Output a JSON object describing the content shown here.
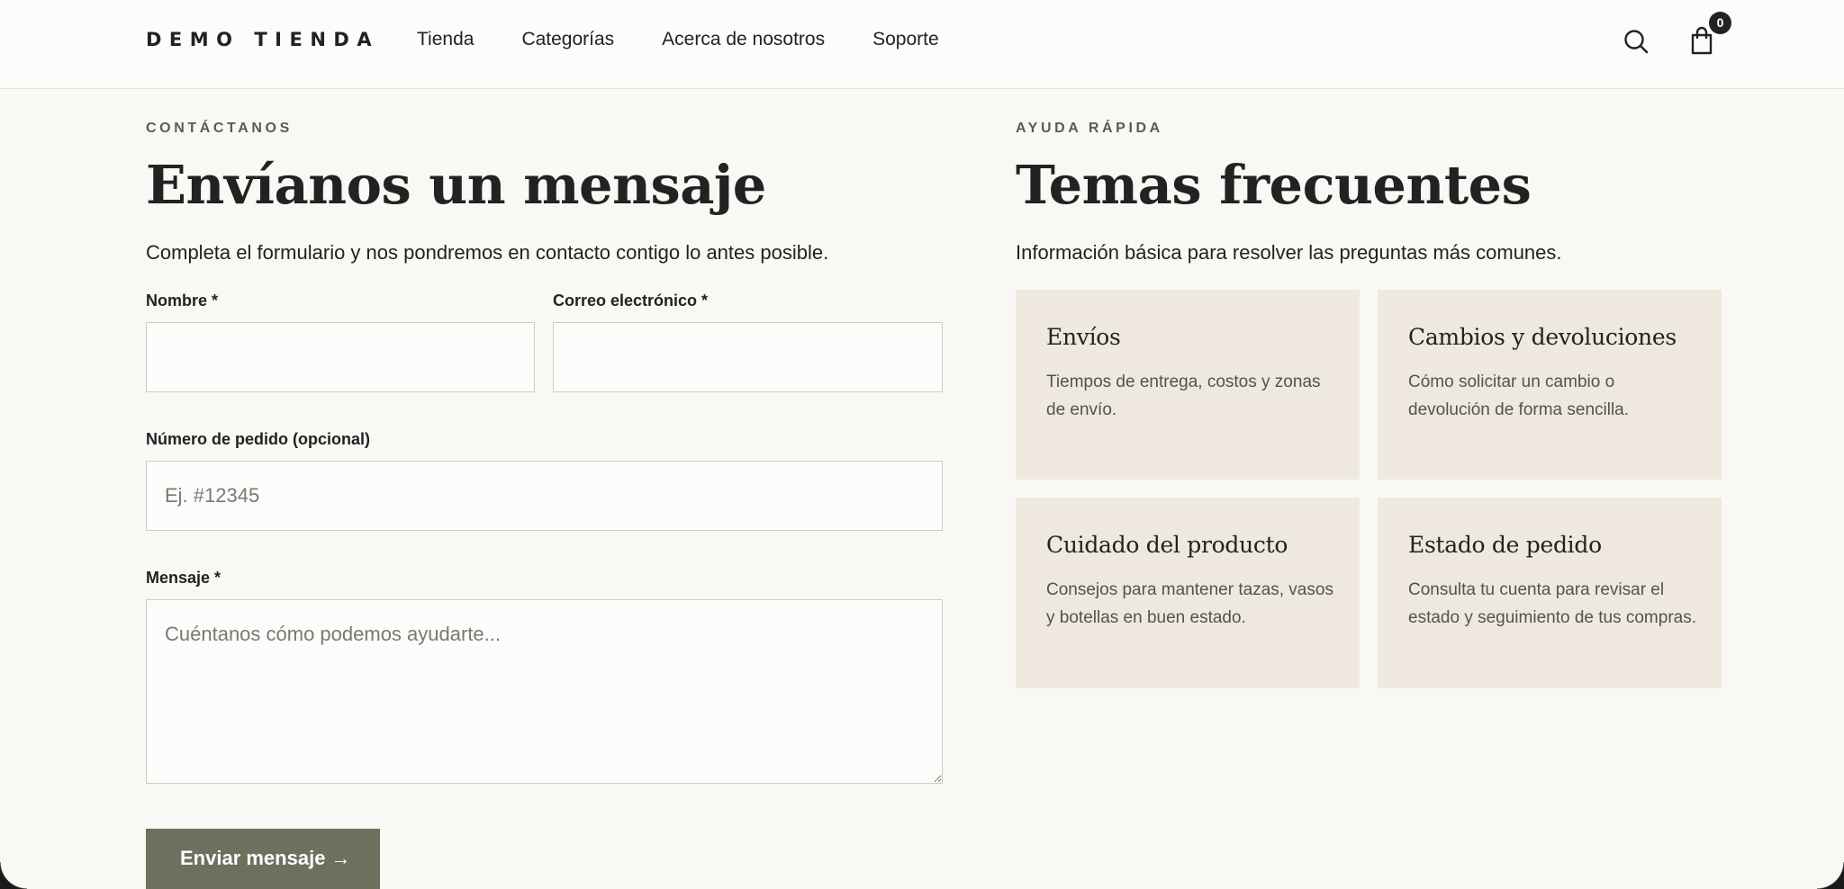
{
  "header": {
    "logo": "DEMO TIENDA",
    "nav": [
      "Tienda",
      "Categorías",
      "Acerca de nosotros",
      "Soporte"
    ],
    "cart_count": "0",
    "icons": [
      "search-icon",
      "shopping-bag-icon"
    ]
  },
  "contact": {
    "eyebrow": "CONTÁCTANOS",
    "title": "Envíanos un mensaje",
    "subtitle": "Completa el formulario y nos pondremos en contacto contigo lo antes posible.",
    "name_label": "Nombre *",
    "name_value": "",
    "email_label": "Correo electrónico *",
    "email_value": "",
    "order_label": "Número de pedido (opcional)",
    "order_placeholder": "Ej. #12345",
    "message_label": "Mensaje *",
    "message_placeholder": "Cuéntanos cómo podemos ayudarte...",
    "submit_label": "Enviar mensaje →",
    "button_color": "#6e6f5d"
  },
  "help": {
    "eyebrow": "AYUDA RÁPIDA",
    "title": "Temas frecuentes",
    "subtitle": "Información básica para resolver las preguntas más comunes.",
    "card_color": "#efe8df",
    "cards": [
      {
        "title": "Envíos",
        "desc": "Tiempos de entrega, costos y zonas de envío."
      },
      {
        "title": "Cambios y devoluciones",
        "desc": "Cómo solicitar un cambio o devolución de forma sencilla."
      },
      {
        "title": "Cuidado del producto",
        "desc": "Consejos para mantener tazas, vasos y botellas en buen estado."
      },
      {
        "title": "Estado de pedido",
        "desc": "Consulta tu cuenta para revisar el estado y seguimiento de tus compras."
      }
    ]
  }
}
